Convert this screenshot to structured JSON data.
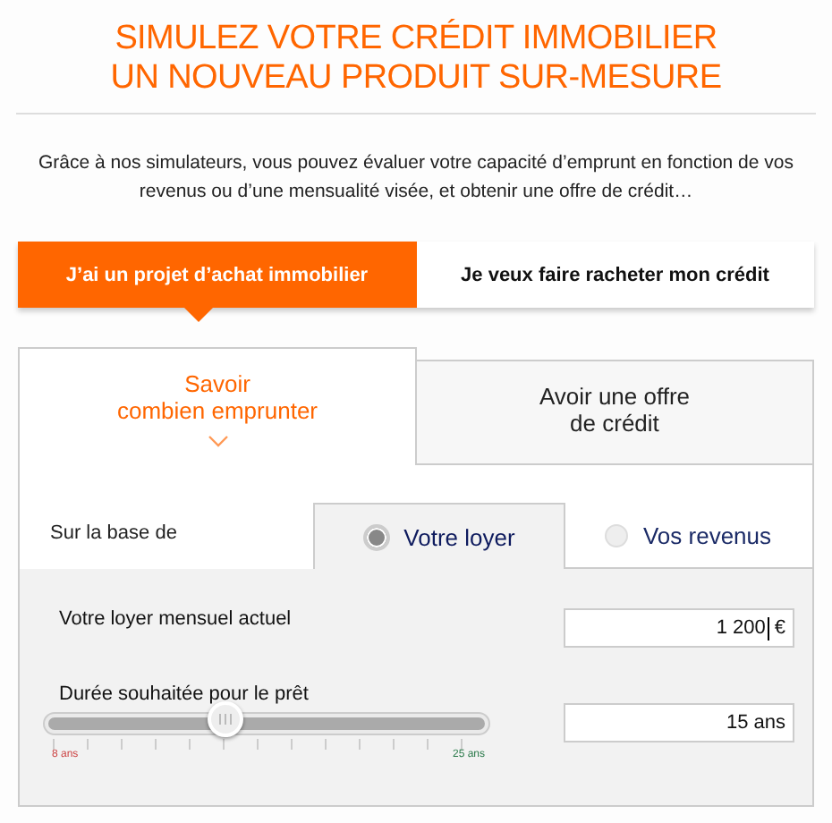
{
  "header": {
    "title_line1": "SIMULEZ VOTRE CRÉDIT IMMOBILIER",
    "title_line2": "UN NOUVEAU PRODUIT SUR-MESURE"
  },
  "intro": "Grâce à nos simulateurs, vous pouvez évaluer votre capacité d’emprunt en fonction de vos revenus ou d’une mensualité visée, et obtenir une offre de crédit…",
  "project_tabs": [
    {
      "label": "J’ai un projet d’achat immobilier",
      "selected": true
    },
    {
      "label": "Je veux faire racheter mon crédit",
      "selected": false
    }
  ],
  "sim_tabs": [
    {
      "line1": "Savoir",
      "line2": "combien emprunter",
      "selected": true
    },
    {
      "line1": "Avoir une offre",
      "line2": "de crédit",
      "selected": false
    }
  ],
  "basis": {
    "label": "Sur la base de",
    "options": [
      {
        "label": "Votre loyer",
        "selected": true
      },
      {
        "label": "Vos revenus",
        "selected": false
      }
    ]
  },
  "fields": [
    {
      "kind": "input",
      "label": "Votre loyer mensuel actuel",
      "value": "1 200",
      "unit": "€"
    },
    {
      "kind": "slider",
      "label": "Durée souhaitée pour le prêt",
      "value": "15 ans",
      "level": 0.41,
      "min_label": "8 ans",
      "max_label": "25 ans"
    }
  ]
}
